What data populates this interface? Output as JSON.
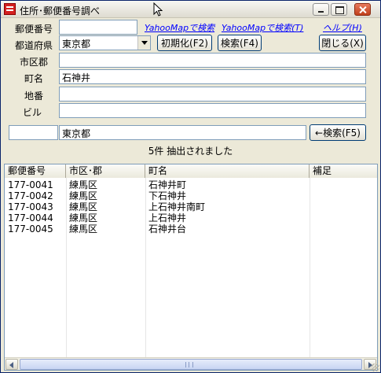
{
  "window": {
    "title": "住所･郵便番号調べ"
  },
  "form": {
    "postal_label": "郵便番号",
    "postal_value": "",
    "prefecture_label": "都道府県",
    "prefecture_value": "東京都",
    "city_label": "市区郡",
    "city_value": "",
    "town_label": "町名",
    "town_value": "石神井",
    "lot_label": "地番",
    "lot_value": "",
    "building_label": "ビル",
    "building_value": ""
  },
  "links": {
    "yahoo_map": "YahooMapで検索",
    "yahoo_map_t": "YahooMapで検索(T)",
    "help": "ヘルプ(H)"
  },
  "buttons": {
    "init": "初期化(F2)",
    "search": "検索(F4)",
    "close": "閉じる(X)",
    "back_search": "←検索(F5)"
  },
  "filter": {
    "left_value": "",
    "prefecture_value": "東京都"
  },
  "status": "5件 抽出されました",
  "table": {
    "columns": [
      "郵便番号",
      "市区･郡",
      "町名",
      "補足"
    ],
    "rows": [
      [
        "177-0041",
        "練馬区",
        "石神井町",
        ""
      ],
      [
        "177-0042",
        "練馬区",
        "下石神井",
        ""
      ],
      [
        "177-0043",
        "練馬区",
        "上石神井南町",
        ""
      ],
      [
        "177-0044",
        "練馬区",
        "上石神井",
        ""
      ],
      [
        "177-0045",
        "練馬区",
        "石神井台",
        ""
      ]
    ]
  }
}
